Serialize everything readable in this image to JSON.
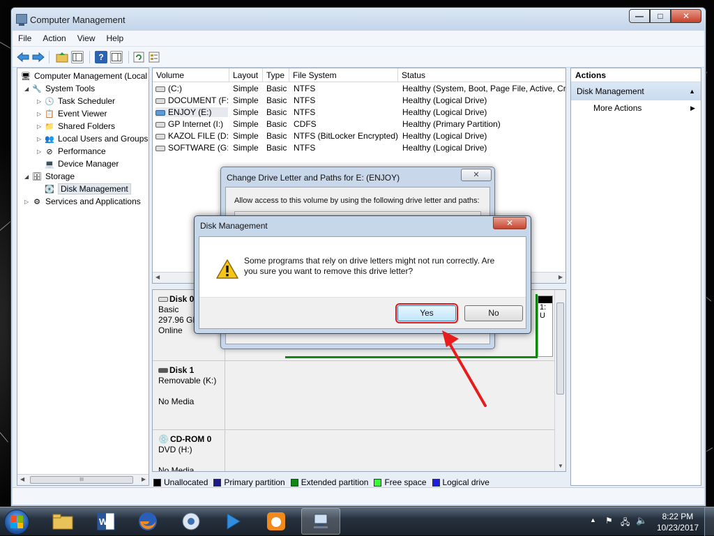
{
  "window": {
    "title": "Computer Management"
  },
  "menu": [
    "File",
    "Action",
    "View",
    "Help"
  ],
  "tree": {
    "root": "Computer Management (Local",
    "system_tools": "System Tools",
    "task_scheduler": "Task Scheduler",
    "event_viewer": "Event Viewer",
    "shared_folders": "Shared Folders",
    "local_users": "Local Users and Groups",
    "performance": "Performance",
    "device_manager": "Device Manager",
    "storage": "Storage",
    "disk_management": "Disk Management",
    "services": "Services and Applications"
  },
  "volumes": {
    "headers": [
      "Volume",
      "Layout",
      "Type",
      "File System",
      "Status"
    ],
    "rows": [
      [
        "(C:)",
        "Simple",
        "Basic",
        "NTFS",
        "Healthy (System, Boot, Page File, Active, Cras"
      ],
      [
        "DOCUMENT (F:)",
        "Simple",
        "Basic",
        "NTFS",
        "Healthy (Logical Drive)"
      ],
      [
        "ENJOY (E:)",
        "Simple",
        "Basic",
        "NTFS",
        "Healthy (Logical Drive)"
      ],
      [
        "GP Internet (I:)",
        "Simple",
        "Basic",
        "CDFS",
        "Healthy (Primary Partition)"
      ],
      [
        "KAZOL FILE (D:)",
        "Simple",
        "Basic",
        "NTFS (BitLocker Encrypted)",
        "Healthy (Logical Drive)"
      ],
      [
        "SOFTWARE (G:)",
        "Simple",
        "Basic",
        "NTFS",
        "Healthy (Logical Drive)"
      ]
    ]
  },
  "disks": {
    "disk0": {
      "name": "Disk 0",
      "type": "Basic",
      "size": "297.96 GB",
      "state": "Online",
      "partial1": "1:",
      "partial2": "U"
    },
    "disk1": {
      "name": "Disk 1",
      "type": "Removable (K:)",
      "state": "No Media"
    },
    "cdrom0": {
      "name": "CD-ROM 0",
      "type": "DVD (H:)",
      "state": "No Media"
    }
  },
  "legend": [
    {
      "label": "Unallocated",
      "color": "#000000"
    },
    {
      "label": "Primary partition",
      "color": "#1a1a8c"
    },
    {
      "label": "Extended partition",
      "color": "#0f8a0f"
    },
    {
      "label": "Free space",
      "color": "#33ff33"
    },
    {
      "label": "Logical drive",
      "color": "#1e1ee0"
    }
  ],
  "actions": {
    "header": "Actions",
    "section": "Disk Management",
    "more": "More Actions"
  },
  "bg_dialog": {
    "title": "Change Drive Letter and Paths for E: (ENJOY)",
    "message": "Allow access to this volume by using the following drive letter and paths:"
  },
  "modal": {
    "title": "Disk Management",
    "message": "Some programs that rely on drive letters might not run correctly. Are you sure you want to remove this drive letter?",
    "yes": "Yes",
    "no": "No"
  },
  "clock": {
    "time": "8:22 PM",
    "date": "10/23/2017"
  },
  "hscroll_glyph": "III",
  "window_buttons": {
    "min": "—",
    "max": "□",
    "close": "✕"
  },
  "dialog_close_glyph": "✕",
  "colors": {
    "accent": "#c7d7ea",
    "yes_outline": "#e01919",
    "arrow": "#e81c1c"
  }
}
